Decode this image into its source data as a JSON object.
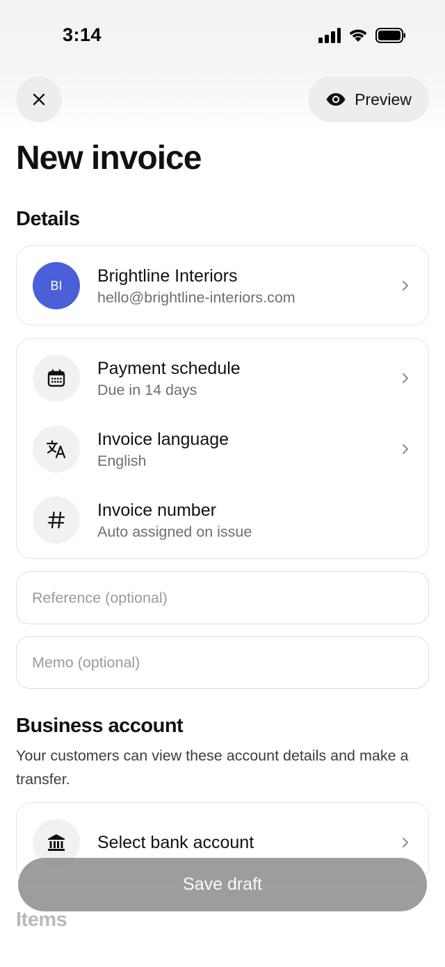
{
  "status_bar": {
    "time": "3:14"
  },
  "header": {
    "close_icon": "close-icon",
    "preview_label": "Preview",
    "preview_icon": "eye-icon",
    "title": "New invoice"
  },
  "details": {
    "heading": "Details",
    "customer": {
      "initials": "BI",
      "name": "Brightline Interiors",
      "email": "hello@brightline-interiors.com",
      "avatar_color": "#4a5fd8"
    },
    "settings": [
      {
        "icon": "calendar-icon",
        "title": "Payment schedule",
        "subtitle": "Due in 14 days"
      },
      {
        "icon": "translate-icon",
        "title": "Invoice language",
        "subtitle": "English"
      },
      {
        "icon": "hash-icon",
        "title": "Invoice number",
        "subtitle": "Auto assigned on issue"
      }
    ],
    "reference_placeholder": "Reference (optional)",
    "memo_placeholder": "Memo (optional)"
  },
  "business_account": {
    "heading": "Business account",
    "description": "Your customers can view these account details and make a transfer.",
    "select_label": "Select bank account",
    "icon": "bank-icon"
  },
  "items": {
    "heading": "Items"
  },
  "footer": {
    "save_label": "Save draft"
  },
  "colors": {
    "accent": "#4a5fd8",
    "icon_bg": "#f1f1f1",
    "button_bg": "#ededed"
  }
}
